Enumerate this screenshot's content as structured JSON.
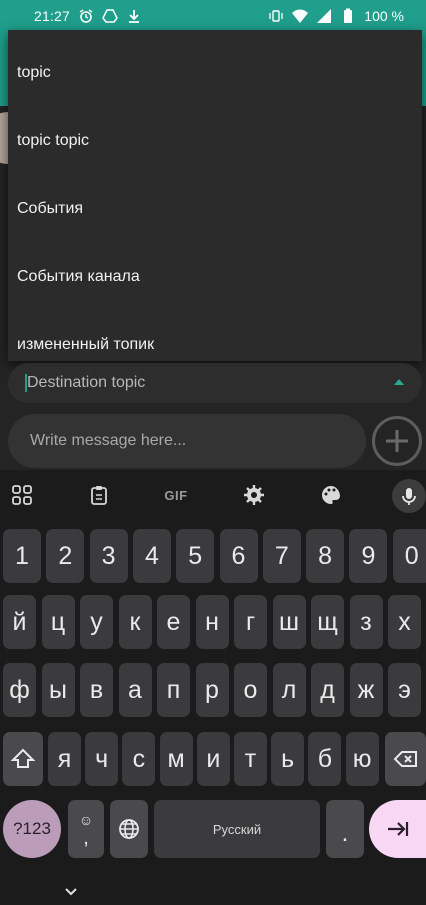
{
  "status_bar": {
    "time": "21:27",
    "battery": "100 %",
    "icons_left": [
      "alarm-icon",
      "drive-icon",
      "download-icon"
    ],
    "icons_right": [
      "vibrate-icon",
      "wifi-icon",
      "signal-icon",
      "battery-icon"
    ]
  },
  "dropdown": {
    "items": [
      "topic",
      "topic topic",
      "События",
      "События канала",
      "измененный топик"
    ]
  },
  "compose": {
    "topic_placeholder": "Destination topic",
    "message_placeholder": "Write message here..."
  },
  "keyboard": {
    "toolbar": {
      "gif_label": "GIF",
      "icons": [
        "apps-grid-icon",
        "clipboard-icon",
        "gif-icon",
        "settings-gear-icon",
        "palette-icon",
        "microphone-icon"
      ]
    },
    "row_numbers": [
      "1",
      "2",
      "3",
      "4",
      "5",
      "6",
      "7",
      "8",
      "9",
      "0"
    ],
    "row1": [
      "й",
      "ц",
      "у",
      "к",
      "е",
      "н",
      "г",
      "ш",
      "щ",
      "з",
      "х"
    ],
    "row2": [
      "ф",
      "ы",
      "в",
      "а",
      "п",
      "р",
      "о",
      "л",
      "д",
      "ж",
      "э"
    ],
    "row3": [
      "я",
      "ч",
      "с",
      "м",
      "и",
      "т",
      "ь",
      "б",
      "ю"
    ],
    "bottom": {
      "symbols_label": "?123",
      "comma_label": ",",
      "space_label": "Русский",
      "period_label": "."
    },
    "colors": {
      "accent": "#1f9f8c",
      "symbols_key": "#bc9db9",
      "enter_key": "#f7d7f4"
    }
  }
}
